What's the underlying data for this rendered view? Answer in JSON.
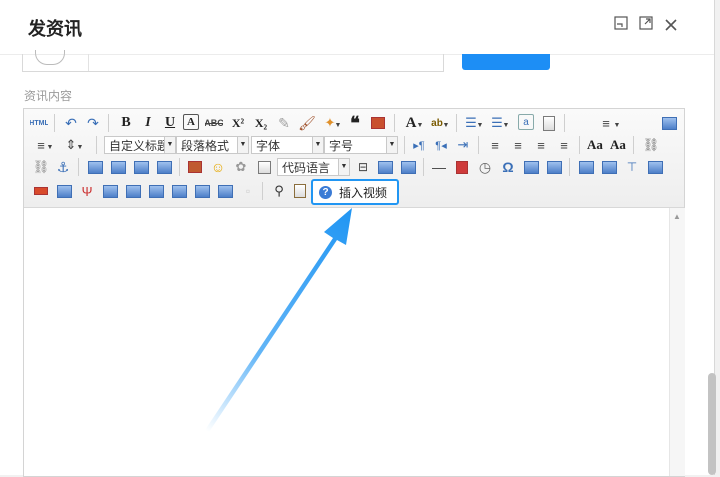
{
  "dialog": {
    "title": "发资讯",
    "icons": [
      "minimize-icon",
      "maximize-icon",
      "close-icon"
    ]
  },
  "form": {
    "content_label": "资讯内容"
  },
  "toolbar": {
    "row1": [
      "html-source",
      "undo",
      "redo",
      "bold",
      "italic",
      "underline",
      "font-border",
      "strikethrough",
      "superscript",
      "subscript",
      "format-brush",
      "remove-format",
      "auto-typeset",
      "blockquote",
      "paste-plain",
      "font-color",
      "background-color",
      "ordered-list",
      "unordered-list",
      "select-all",
      "clear-doc",
      "row-spacing",
      "fullscreen"
    ],
    "combos": {
      "custom_title": "自定义标题",
      "paragraph": "段落格式",
      "font_family": "字体",
      "font_size": "字号",
      "code_language": "代码语言"
    },
    "tooltip": "插入视频",
    "tooltip_icon": "help-circle-icon",
    "accent_color": "#2196f3"
  }
}
